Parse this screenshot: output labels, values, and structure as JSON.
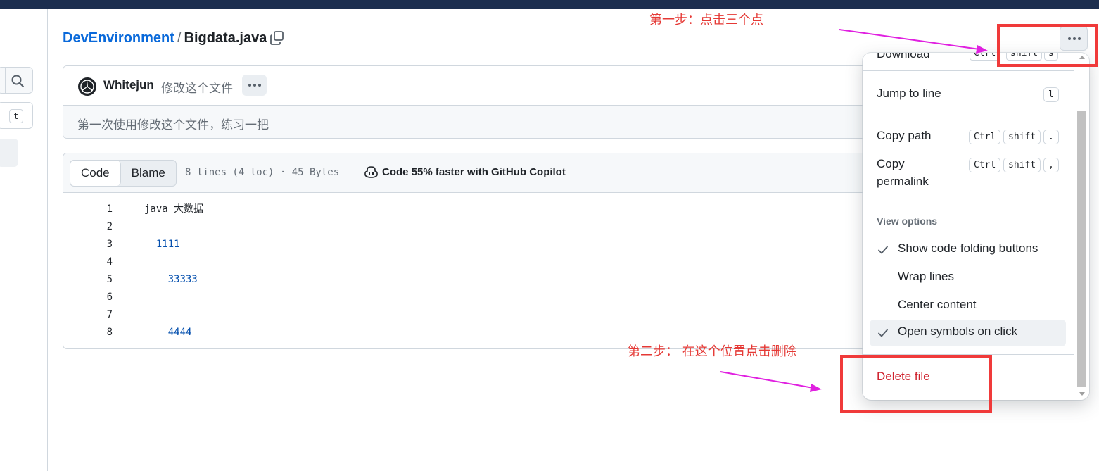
{
  "breadcrumb": {
    "repo": "DevEnvironment",
    "separator": "/",
    "file": "Bigdata.java"
  },
  "sidebar": {
    "search_icon": "search-icon",
    "key_hint": "t"
  },
  "commit": {
    "author": "Whitejun",
    "message": "修改这个文件",
    "description": "第一次使用修改这个文件，练习一把"
  },
  "code_view": {
    "tabs": [
      "Code",
      "Blame"
    ],
    "active_tab": "Code",
    "meta": "8 lines (4 loc) · 45 Bytes",
    "copilot_text": "Code 55% faster with GitHub Copilot",
    "lines": [
      {
        "n": "1",
        "text": "java 大数据",
        "kind": "text"
      },
      {
        "n": "2",
        "text": "",
        "kind": "text"
      },
      {
        "n": "3",
        "text": "  1111",
        "kind": "num"
      },
      {
        "n": "4",
        "text": "",
        "kind": "text"
      },
      {
        "n": "5",
        "text": "    33333",
        "kind": "num"
      },
      {
        "n": "6",
        "text": "",
        "kind": "text"
      },
      {
        "n": "7",
        "text": "",
        "kind": "text"
      },
      {
        "n": "8",
        "text": "    4444",
        "kind": "num"
      }
    ]
  },
  "menu": {
    "clipped_item": "Download",
    "clipped_keys": [
      "Ctrl",
      "shift",
      "s"
    ],
    "jump_to_line": {
      "label": "Jump to line",
      "key": "l"
    },
    "copy_path": {
      "label": "Copy path",
      "keys": [
        "Ctrl",
        "shift",
        "."
      ]
    },
    "copy_permalink": {
      "label_line1": "Copy",
      "label_line2": "permalink",
      "keys": [
        "Ctrl",
        "shift",
        ","
      ]
    },
    "view_options_label": "View options",
    "options": [
      {
        "label": "Show code folding buttons",
        "checked": true
      },
      {
        "label": "Wrap lines",
        "checked": false
      },
      {
        "label": "Center content",
        "checked": false
      },
      {
        "label": "Open symbols on click",
        "checked": true,
        "highlighted": true
      }
    ],
    "delete_label": "Delete file"
  },
  "annotations": {
    "step1": "第一步：点击三个点",
    "step2": "第二步： 在这个位置点击删除"
  },
  "colors": {
    "link": "#0969da",
    "danger": "#cf222e",
    "annotation_red": "#e53935",
    "annotation_arrow": "#e020e0",
    "topbar": "#1c2e4f"
  }
}
